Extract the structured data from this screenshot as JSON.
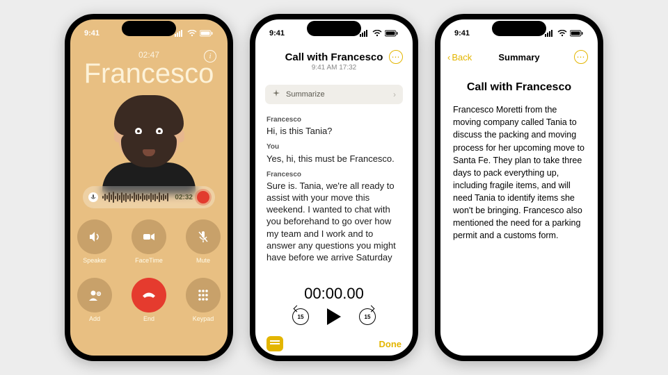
{
  "status_time": "9:41",
  "phone1": {
    "duration": "02:47",
    "caller": "Francesco",
    "rec_time": "02:32",
    "buttons": {
      "speaker": "Speaker",
      "facetime": "FaceTime",
      "mute": "Mute",
      "add": "Add",
      "end": "End",
      "keypad": "Keypad"
    }
  },
  "phone2": {
    "title": "Call with Francesco",
    "subtitle": "9:41 AM  17:32",
    "summarize_label": "Summarize",
    "skip_amount": "15",
    "transcript": [
      {
        "speaker": "Francesco",
        "text": "Hi, is this Tania?"
      },
      {
        "speaker": "You",
        "text": "Yes, hi, this must be Francesco."
      },
      {
        "speaker": "Francesco",
        "text": "Sure is. Tania, we're all ready to assist with your move this weekend. I wanted to chat with you beforehand to go over how my team and I work and to answer any questions you might have before we arrive Saturday"
      }
    ],
    "player_time": "00:00.00",
    "done_label": "Done"
  },
  "phone3": {
    "back_label": "Back",
    "nav_title": "Summary",
    "heading": "Call with Francesco",
    "body": "Francesco Moretti from the moving company called Tania to discuss the packing and moving process for her upcoming move to Santa Fe. They plan to take three days to pack everything up, including fragile items, and will need Tania to identify items she won't be bringing. Francesco also mentioned the need for a parking permit and a customs form."
  }
}
